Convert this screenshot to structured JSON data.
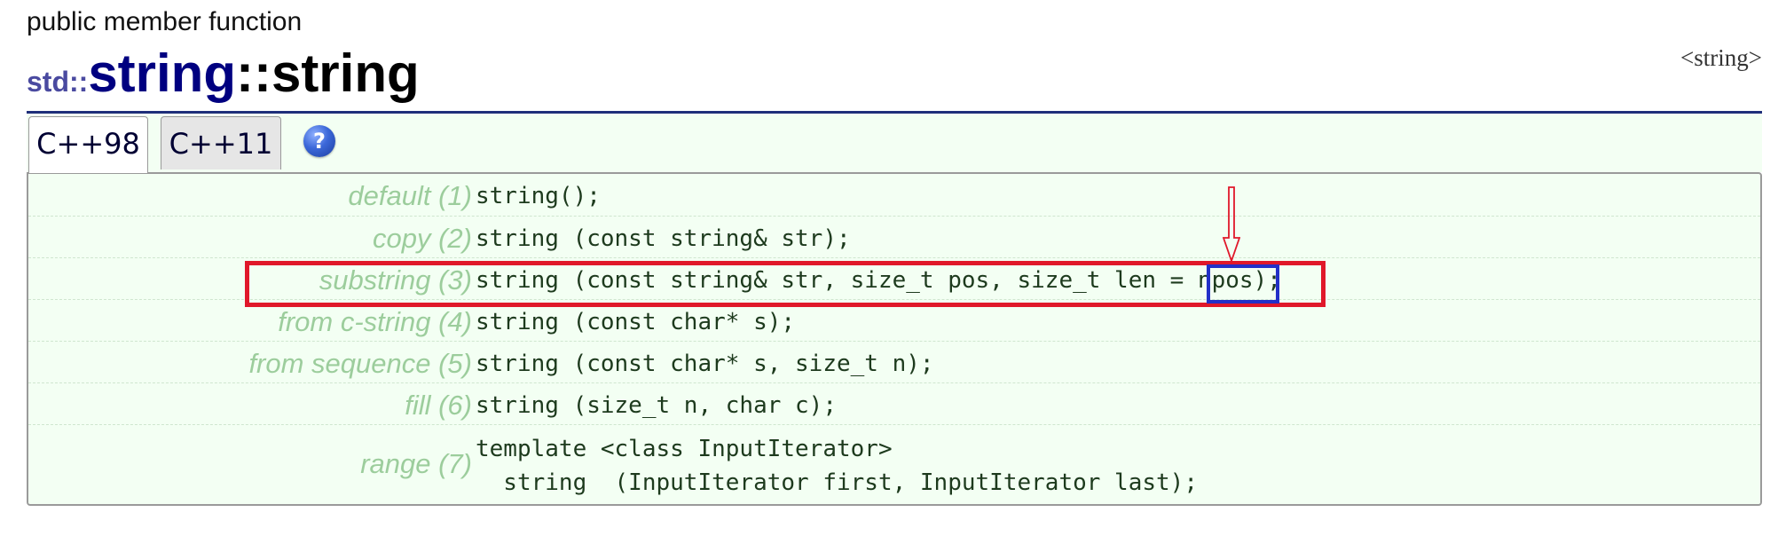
{
  "header": {
    "kind": "public member function",
    "namespace": "std::",
    "class_name": "string",
    "separator": "::",
    "member_name": "string",
    "header_file": "<string>"
  },
  "tabs": [
    {
      "label": "C++98",
      "active": true
    },
    {
      "label": "C++11",
      "active": false
    }
  ],
  "help_icon": {
    "glyph": "?",
    "icon": "help-circle-icon"
  },
  "overloads": [
    {
      "label": "default (1)",
      "code": "string();"
    },
    {
      "label": "copy (2)",
      "code": "string (const string& str);"
    },
    {
      "label": "substring (3)",
      "code": "string (const string& str, size_t pos, size_t len = npos);"
    },
    {
      "label": "from c-string (4)",
      "code": "string (const char* s);"
    },
    {
      "label": "from sequence (5)",
      "code": "string (const char* s, size_t n);"
    },
    {
      "label": "fill (6)",
      "code": "string (size_t n, char c);"
    },
    {
      "label": "range (7)",
      "code": "template <class InputIterator>\n  string  (InputIterator first, InputIterator last);"
    }
  ],
  "annotations": {
    "highlighted_row": "substring (3)",
    "highlighted_token": "npos",
    "red_box_color": "#e0182a",
    "blue_box_color": "#2330c8",
    "arrow_color": "#e0182a"
  },
  "colors": {
    "panel_bg": "#f3fff3",
    "label_color": "#9ccd9c",
    "header_rule": "#1f2f7a",
    "class_color": "#000080",
    "namespace_color": "#4a4aa0"
  }
}
